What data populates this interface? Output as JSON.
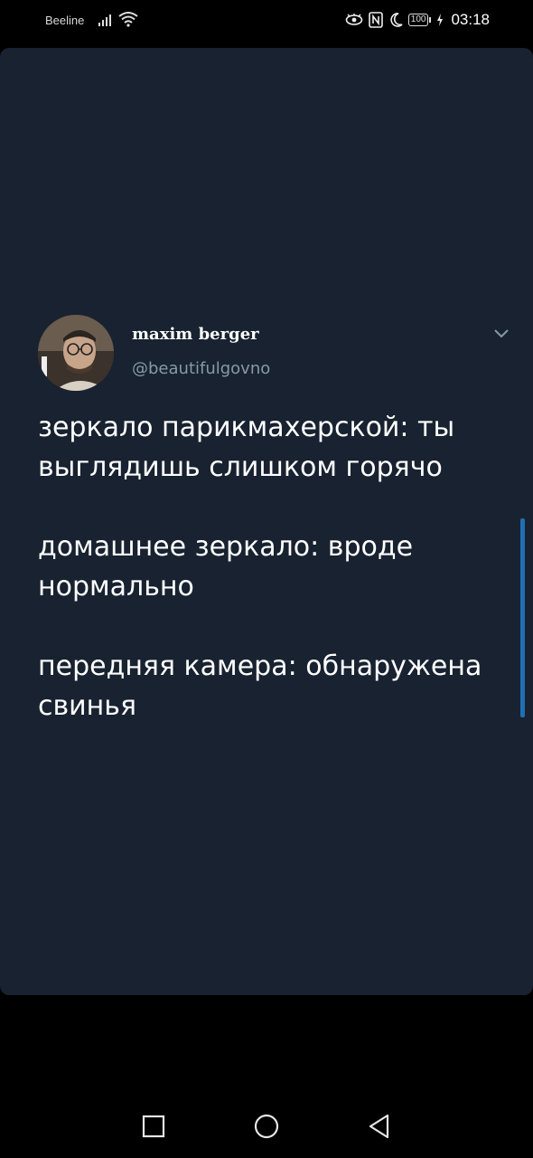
{
  "status_bar": {
    "carrier": "Beeline",
    "battery": "100",
    "time": "03:18",
    "icons": [
      "signal-icon",
      "wifi-icon",
      "eye-icon",
      "nfc-icon",
      "moon-icon",
      "battery-icon",
      "charging-icon"
    ]
  },
  "tweet": {
    "display_name": "maxim berger",
    "handle": "@beautifulgovno",
    "paragraphs": [
      "зеркало парикмахерской: ты выглядишь слишком горячо",
      "домашнее зеркало: вроде нормально",
      "передняя камера: обнаружена свинья"
    ]
  },
  "colors": {
    "card_background": "#182230",
    "handle": "#8899a6",
    "scrollbar": "#1f6fb5"
  },
  "nav_bar": {
    "buttons": [
      "recent-apps-icon",
      "home-icon",
      "back-icon"
    ]
  }
}
